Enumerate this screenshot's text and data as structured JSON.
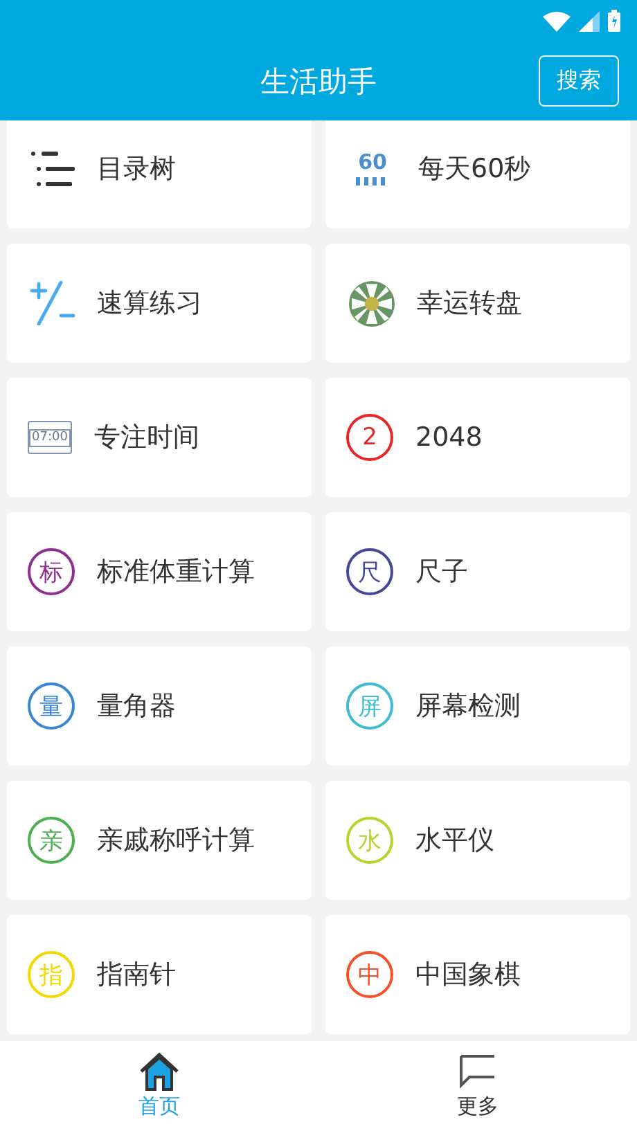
{
  "header": {
    "title": "生活助手",
    "search_button": "搜索"
  },
  "tools": [
    {
      "kind": "list",
      "label": "目录树"
    },
    {
      "kind": "sixty",
      "label": "每天60秒",
      "icon_text": "60"
    },
    {
      "kind": "plusminus",
      "label": "速算练习"
    },
    {
      "kind": "wheel",
      "label": "幸运转盘"
    },
    {
      "kind": "clock",
      "label": "专注时间",
      "icon_text": "07:00"
    },
    {
      "kind": "circle",
      "label": "2048",
      "icon_text": "2",
      "color": "#e8262a"
    },
    {
      "kind": "circle",
      "label": "标准体重计算",
      "icon_text": "标",
      "color": "#8e2f8f"
    },
    {
      "kind": "circle",
      "label": "尺子",
      "icon_text": "尺",
      "color": "#46469a"
    },
    {
      "kind": "circle",
      "label": "量角器",
      "icon_text": "量",
      "color": "#3a86d4"
    },
    {
      "kind": "circle",
      "label": "屏幕检测",
      "icon_text": "屏",
      "color": "#3fbcd2"
    },
    {
      "kind": "circle",
      "label": "亲戚称呼计算",
      "icon_text": "亲",
      "color": "#4cb050"
    },
    {
      "kind": "circle",
      "label": "水平仪",
      "icon_text": "水",
      "color": "#b8d42c"
    },
    {
      "kind": "circle",
      "label": "指南针",
      "icon_text": "指",
      "color": "#f4d800"
    },
    {
      "kind": "circle",
      "label": "中国象棋",
      "icon_text": "中",
      "color": "#f0522a"
    }
  ],
  "bottom_nav": [
    {
      "kind": "home",
      "label": "首页",
      "selected": true
    },
    {
      "kind": "more",
      "label": "更多",
      "selected": false
    }
  ]
}
